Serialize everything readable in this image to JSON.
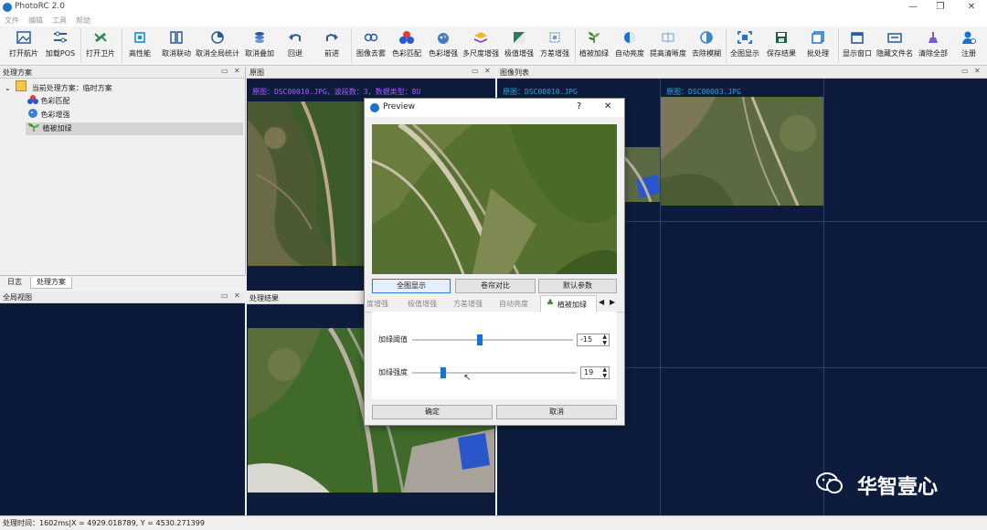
{
  "window": {
    "title": "PhotoRC 2.0",
    "minimize": "—",
    "restore": "❐",
    "close": "✕"
  },
  "menu": [
    "文件",
    "编辑",
    "工具",
    "帮助"
  ],
  "toolbar": [
    {
      "label": "打开航片",
      "icon": "image-icon"
    },
    {
      "label": "加载POS",
      "icon": "pos-icon"
    },
    {
      "label": "打开卫片",
      "icon": "satellite-icon"
    },
    {
      "label": "高性能",
      "icon": "cpu-icon"
    },
    {
      "label": "取消联动",
      "icon": "unlink-icon"
    },
    {
      "label": "取消全局统计",
      "icon": "stats-icon"
    },
    {
      "label": "取消叠加",
      "icon": "layers-icon"
    },
    {
      "label": "回退",
      "icon": "undo-icon"
    },
    {
      "label": "前进",
      "icon": "redo-icon"
    },
    {
      "label": "图像去雾",
      "icon": "dehaze-icon"
    },
    {
      "label": "色彩匹配",
      "icon": "color-match-icon"
    },
    {
      "label": "色彩增强",
      "icon": "color-enhance-icon"
    },
    {
      "label": "多尺度增强",
      "icon": "multiscale-icon"
    },
    {
      "label": "极值增强",
      "icon": "extreme-icon"
    },
    {
      "label": "方差增强",
      "icon": "variance-icon"
    },
    {
      "label": "植被加绿",
      "icon": "plant-icon"
    },
    {
      "label": "自动亮度",
      "icon": "brightness-icon"
    },
    {
      "label": "提高清晰度",
      "icon": "sharpen-icon"
    },
    {
      "label": "去除模糊",
      "icon": "deblur-icon"
    },
    {
      "label": "全图显示",
      "icon": "fit-icon"
    },
    {
      "label": "保存结果",
      "icon": "save-icon"
    },
    {
      "label": "批处理",
      "icon": "batch-icon"
    },
    {
      "label": "显示窗口",
      "icon": "window-icon"
    },
    {
      "label": "隐藏文件名",
      "icon": "hide-name-icon"
    },
    {
      "label": "清除全部",
      "icon": "clear-icon"
    },
    {
      "label": "注册",
      "icon": "register-icon"
    }
  ],
  "panels": {
    "scheme": {
      "title": "处理方案",
      "root": "当前处理方案：临时方案",
      "items": [
        "色彩匹配",
        "色彩增强",
        "植被加绿"
      ]
    },
    "left_tabs": [
      "日志",
      "处理方案"
    ],
    "global_view": {
      "title": "全局视图"
    },
    "original": {
      "title": "原图",
      "info": "原图：DSC00010.JPG，波段数：3，数据类型：8U"
    },
    "result": {
      "title": "处理结果"
    },
    "image_list": {
      "title": "图像列表",
      "items": [
        "原图：DSC00010.JPG",
        "原图：DSC00003.JPG"
      ]
    }
  },
  "dialog": {
    "title": "Preview",
    "help": "?",
    "close": "✕",
    "buttons": [
      "全图显示",
      "卷帘对比",
      "默认参数"
    ],
    "tabs": [
      "度增强",
      "极值增强",
      "方差增强",
      "自动亮度",
      "植被加绿"
    ],
    "active_tab": "植被加绿",
    "params": [
      {
        "label": "加绿阈值",
        "value": "-15",
        "level": 0.42
      },
      {
        "label": "加绿强度",
        "value": "19",
        "level": 0.19
      }
    ],
    "ok": "确定",
    "cancel": "取消"
  },
  "status": "处理时间：1602ms|X = 4929.018789, Y = 4530.271399",
  "watermark": "华智壹心",
  "colors": {
    "panel_bg": "#0d1c3c",
    "accent": "#1a72d0",
    "info_text": "#a85cff",
    "list_text": "#2fa4d8"
  }
}
